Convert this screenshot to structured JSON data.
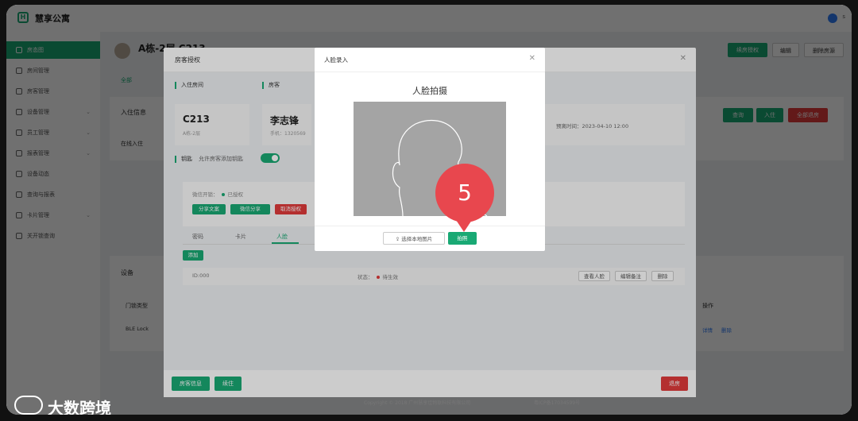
{
  "app": {
    "brand": "慧享公寓",
    "user": "s"
  },
  "sidebar": {
    "items": [
      {
        "label": "房态图",
        "active": true
      },
      {
        "label": "房间管理",
        "active": false
      },
      {
        "label": "房客管理",
        "active": false
      },
      {
        "label": "设备管理",
        "active": false
      },
      {
        "label": "员工管理",
        "active": false
      },
      {
        "label": "报表管理",
        "active": false
      },
      {
        "label": "设备动态",
        "active": false
      },
      {
        "label": "查询与报表",
        "active": false
      },
      {
        "label": "卡片管理",
        "active": false
      },
      {
        "label": "关开锁查询",
        "active": false
      }
    ]
  },
  "main": {
    "room_title": "A栋-2层 C213",
    "header_buttons": [
      "续房授权",
      "编辑",
      "删除房源"
    ],
    "tab": "全部",
    "checkin_label": "入住信息",
    "occupying_label": "在线入住",
    "guest_label": "房客",
    "filter_buttons": [
      "查询",
      "入住",
      "全部退房"
    ],
    "device_label": "设备",
    "lock_type_header": "门锁类型",
    "op_header": "操作",
    "lock_type_value": "BLE Lock",
    "op_links": [
      "详情",
      "删除"
    ]
  },
  "auth_dialog": {
    "title": "房客授权",
    "room_section": "入住房间",
    "guest_section": "房客",
    "room_no": "C213",
    "room_floor": "A栋-2层",
    "guest_name": "李志锋",
    "guest_phone": "手机：1320569",
    "checkout_time": "预离时间：2023-04-10 12:00",
    "key_label": "钥匙",
    "key_permission": "允许房客添加钥匙",
    "wechat_status_label": "微信开锁：",
    "wechat_status_value": "已授权",
    "wechat_buttons": [
      "分享文案",
      "微信分享",
      "取消授权"
    ],
    "tabs": [
      "密码",
      "卡片",
      "人脸"
    ],
    "active_tab": "人脸",
    "add_button": "添加",
    "face_id": "ID:000",
    "face_state_label": "状态：",
    "face_state_value": "待生效",
    "row_buttons": [
      "查看人脸",
      "编辑备注",
      "删除"
    ],
    "footer_left": [
      "房客信息",
      "续住"
    ],
    "footer_right": "退房"
  },
  "face_dialog": {
    "title": "人脸录入",
    "heading": "人脸拍摄",
    "upload_button": "选择本地图片",
    "shoot_button": "拍照"
  },
  "step_marker": "5",
  "footer": {
    "copyright": "Copyright © 2018 广州慧享佳物联科技有限公司",
    "icp": "粤ICP备17034599号"
  },
  "watermark": {
    "text": "大数跨境"
  },
  "colors": {
    "primary": "#19a974",
    "danger": "#e23b3b",
    "marker": "#e8474e"
  }
}
